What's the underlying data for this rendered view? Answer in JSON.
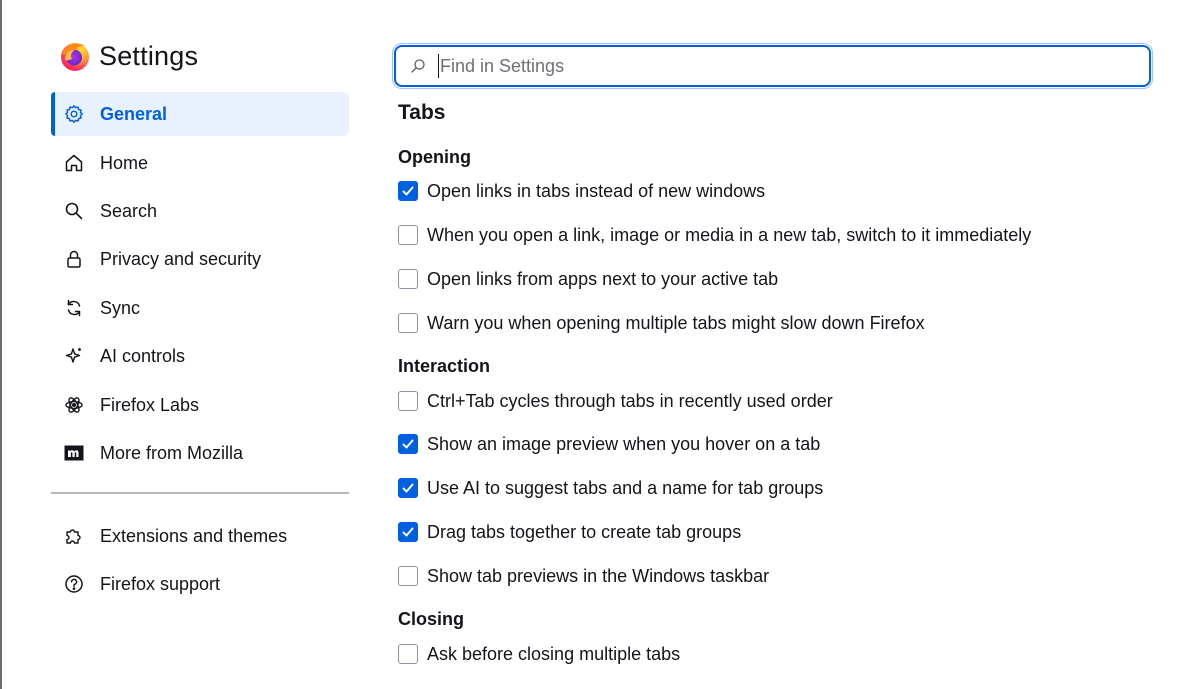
{
  "app": {
    "title": "Settings"
  },
  "search": {
    "placeholder": "Find in Settings",
    "value": ""
  },
  "sidebar": {
    "items": [
      {
        "label": "General",
        "icon": "gear-icon",
        "active": true
      },
      {
        "label": "Home",
        "icon": "home-icon"
      },
      {
        "label": "Search",
        "icon": "search-icon"
      },
      {
        "label": "Privacy and security",
        "icon": "lock-icon"
      },
      {
        "label": "Sync",
        "icon": "sync-icon"
      },
      {
        "label": "AI controls",
        "icon": "sparkle-icon"
      },
      {
        "label": "Firefox Labs",
        "icon": "labs-icon"
      },
      {
        "label": "More from Mozilla",
        "icon": "mozilla-icon"
      }
    ],
    "footer": [
      {
        "label": "Extensions and themes",
        "icon": "puzzle-icon"
      },
      {
        "label": "Firefox support",
        "icon": "help-icon"
      }
    ]
  },
  "main": {
    "section_title": "Tabs",
    "groups": [
      {
        "heading": "Opening",
        "options": [
          {
            "label": "Open links in tabs instead of new windows",
            "checked": true
          },
          {
            "label": "When you open a link, image or media in a new tab, switch to it immediately",
            "checked": false
          },
          {
            "label": "Open links from apps next to your active tab",
            "checked": false
          },
          {
            "label": "Warn you when opening multiple tabs might slow down Firefox",
            "checked": false
          }
        ]
      },
      {
        "heading": "Interaction",
        "options": [
          {
            "label": "Ctrl+Tab cycles through tabs in recently used order",
            "checked": false
          },
          {
            "label": "Show an image preview when you hover on a tab",
            "checked": true
          },
          {
            "label": "Use AI to suggest tabs and a name for tab groups",
            "checked": true
          },
          {
            "label": "Drag tabs together to create tab groups",
            "checked": true
          },
          {
            "label": "Show tab previews in the Windows taskbar",
            "checked": false
          }
        ]
      },
      {
        "heading": "Closing",
        "options": [
          {
            "label": "Ask before closing multiple tabs",
            "checked": false
          }
        ]
      }
    ]
  },
  "colors": {
    "accent": "#0061e0",
    "active_bg": "#e9f1fd",
    "text": "#15141a"
  }
}
